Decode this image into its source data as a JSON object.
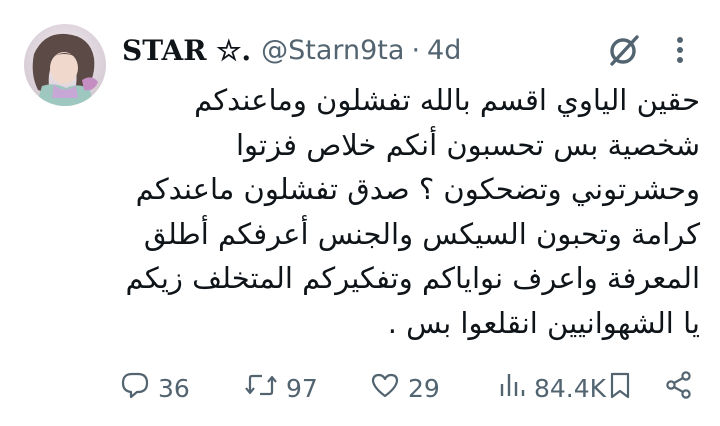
{
  "tweet": {
    "author": {
      "display_name": "STAR ☆.",
      "handle": "@Starn9ta",
      "separator": "·",
      "time": "4d"
    },
    "text": "حقين الياوي اقسم بالله تفشلون وماعندكم\nشخصية بس تحسبون أنكم خلاص فزتوا\nوحشرتوني وتضحكون ؟ صدق تفشلون ماعندكم\nكرامة وتحبون السيكس والجنس أعرفكم أطلق\nالمعرفة واعرف نواياكم وتفكيركم المتخلف زيكم\nيا الشهوانيين انقلعوا بس .",
    "actions": {
      "replies": "36",
      "reposts": "97",
      "likes": "29",
      "views": "84.4K"
    },
    "icons": {
      "reply": "reply-icon",
      "repost": "repost-icon",
      "like": "heart-icon",
      "views": "views-icon",
      "bookmark": "bookmark-icon",
      "share": "share-icon",
      "grok": "grok-icon",
      "more": "more-icon"
    },
    "colors": {
      "text": "#0f1419",
      "secondary": "#536471",
      "background": "#ffffff"
    }
  }
}
